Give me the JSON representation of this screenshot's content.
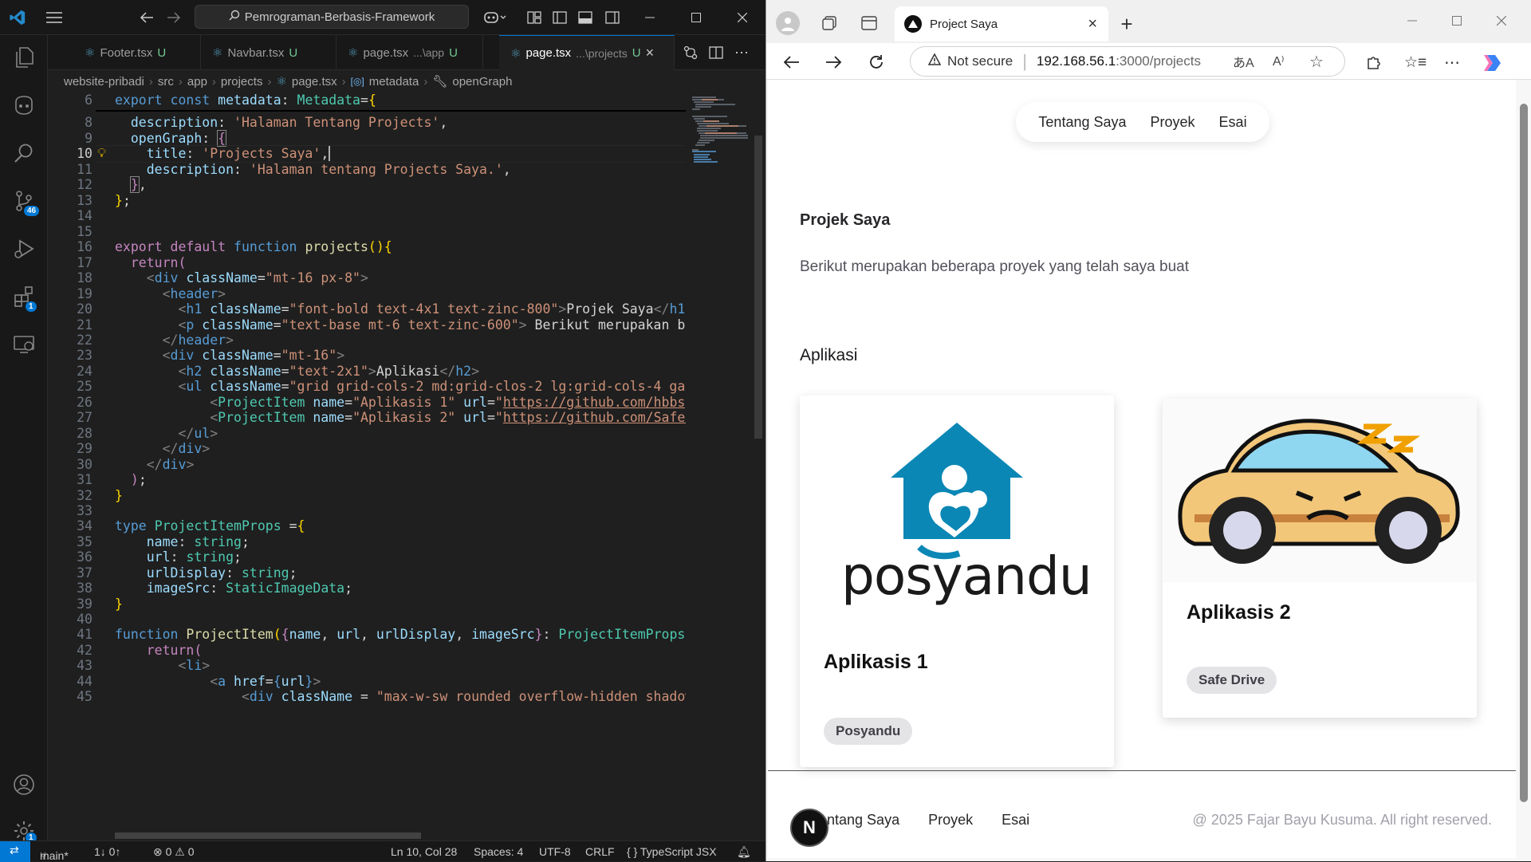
{
  "vscode": {
    "search": "Pemrograman-Berbasis-Framework",
    "tabs": [
      {
        "name": "Footer.tsx",
        "status": "U",
        "dir": ""
      },
      {
        "name": "Navbar.tsx",
        "status": "U",
        "dir": ""
      },
      {
        "name": "page.tsx",
        "status": "U",
        "dir": "...\\app"
      },
      {
        "name": "page.tsx",
        "status": "U",
        "dir": "...\\projects"
      }
    ],
    "breadcrumbs": [
      "website-pribadi",
      "src",
      "app",
      "projects",
      "page.tsx",
      "metadata",
      "openGraph"
    ],
    "badges": {
      "scm": "46",
      "extensions": "1",
      "settings": "1"
    },
    "line_numbers": [
      "6",
      "8",
      "9",
      "10",
      "11",
      "12",
      "13",
      "14",
      "15",
      "16",
      "17",
      "18",
      "19",
      "20",
      "21",
      "22",
      "23",
      "24",
      "25",
      "26",
      "27",
      "28",
      "29",
      "30",
      "31",
      "32",
      "33",
      "34",
      "35",
      "36",
      "37",
      "38",
      "39",
      "40",
      "41",
      "42",
      "43",
      "44",
      "45"
    ],
    "current_line": "10",
    "status": {
      "branch": "main*",
      "sync": "1↓ 0↑",
      "problems": "⊗ 0 ⚠ 0",
      "position": "Ln 10, Col 28",
      "spaces": "Spaces: 4",
      "encoding": "UTF-8",
      "eol": "CRLF",
      "language": "{ } TypeScript JSX"
    }
  },
  "browser": {
    "tab_title": "Project Saya",
    "security": "Not secure",
    "url_host": "192.168.56.1",
    "url_path": ":3000/projects",
    "nav": [
      "Tentang Saya",
      "Proyek",
      "Esai"
    ],
    "heading": "Projek Saya",
    "intro": "Berikut merupakan beberapa proyek yang telah saya buat",
    "section": "Aplikasi",
    "projects": [
      {
        "title": "Aplikasis 1",
        "tag": "Posyandu",
        "logo_text": "posyandu"
      },
      {
        "title": "Aplikasis 2",
        "tag": "Safe Drive"
      }
    ],
    "footer_nav": [
      "Tentang Saya",
      "Proyek",
      "Esai"
    ],
    "copyright": "@ 2025 Fajar Bayu Kusuma. All right reserved.",
    "dev_badge": "N"
  }
}
